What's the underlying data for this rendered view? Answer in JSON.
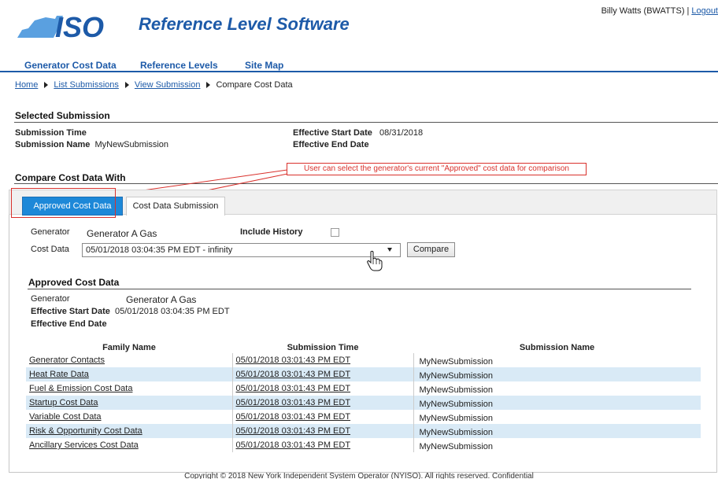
{
  "header": {
    "logo_text": "ISO",
    "app_title": "Reference Level Software",
    "user": "Billy Watts (BWATTS)",
    "separator": "|",
    "logout": "Logout"
  },
  "mainnav": [
    "Generator Cost Data",
    "Reference Levels",
    "Site Map"
  ],
  "breadcrumb": [
    "Home",
    "List Submissions",
    "View Submission",
    "Compare Cost Data"
  ],
  "selected_submission": {
    "title": "Selected Submission",
    "submission_time_label": "Submission Time",
    "submission_time_value": "",
    "submission_name_label": "Submission Name",
    "submission_name_value": "MyNewSubmission",
    "eff_start_label": "Effective Start Date",
    "eff_start_value": "08/31/2018",
    "eff_end_label": "Effective End Date",
    "eff_end_value": ""
  },
  "compare": {
    "title": "Compare Cost Data With",
    "callout": "User can select the generator's current \"Approved\" cost data for comparison",
    "tabs": [
      "Approved Cost Data",
      "Cost Data Submission"
    ],
    "generator_label": "Generator",
    "generator_value": "Generator A Gas",
    "include_history_label": "Include History",
    "cost_data_label": "Cost Data",
    "cost_data_selected": "05/01/2018 03:04:35 PM EDT - infinity",
    "compare_button": "Compare"
  },
  "approved": {
    "title": "Approved Cost Data",
    "generator_label": "Generator",
    "generator_value": "Generator A Gas",
    "eff_start_label": "Effective Start Date",
    "eff_start_value": "05/01/2018 03:04:35 PM EDT",
    "eff_end_label": "Effective End Date",
    "eff_end_value": "",
    "columns": [
      "Family Name",
      "Submission Time",
      "Submission Name"
    ],
    "rows": [
      {
        "family": "Generator Contacts",
        "time": "05/01/2018 03:01:43 PM EDT",
        "name": "MyNewSubmission"
      },
      {
        "family": "Heat Rate Data",
        "time": "05/01/2018 03:01:43 PM EDT",
        "name": "MyNewSubmission"
      },
      {
        "family": "Fuel & Emission Cost Data",
        "time": "05/01/2018 03:01:43 PM EDT",
        "name": "MyNewSubmission"
      },
      {
        "family": "Startup Cost Data",
        "time": "05/01/2018 03:01:43 PM EDT",
        "name": "MyNewSubmission"
      },
      {
        "family": "Variable Cost Data",
        "time": "05/01/2018 03:01:43 PM EDT",
        "name": "MyNewSubmission"
      },
      {
        "family": "Risk & Opportunity Cost Data",
        "time": "05/01/2018 03:01:43 PM EDT",
        "name": "MyNewSubmission"
      },
      {
        "family": "Ancillary Services Cost Data",
        "time": "05/01/2018 03:01:43 PM EDT",
        "name": "MyNewSubmission"
      }
    ]
  },
  "footer": "Copyright © 2018 New York Independent System Operator (NYISO). All rights reserved. Confidential",
  "colors": {
    "brand_blue": "#1d5aa8",
    "tab_active": "#1d88d8",
    "callout_red": "#d9312c",
    "row_alt": "#d9eaf6"
  }
}
